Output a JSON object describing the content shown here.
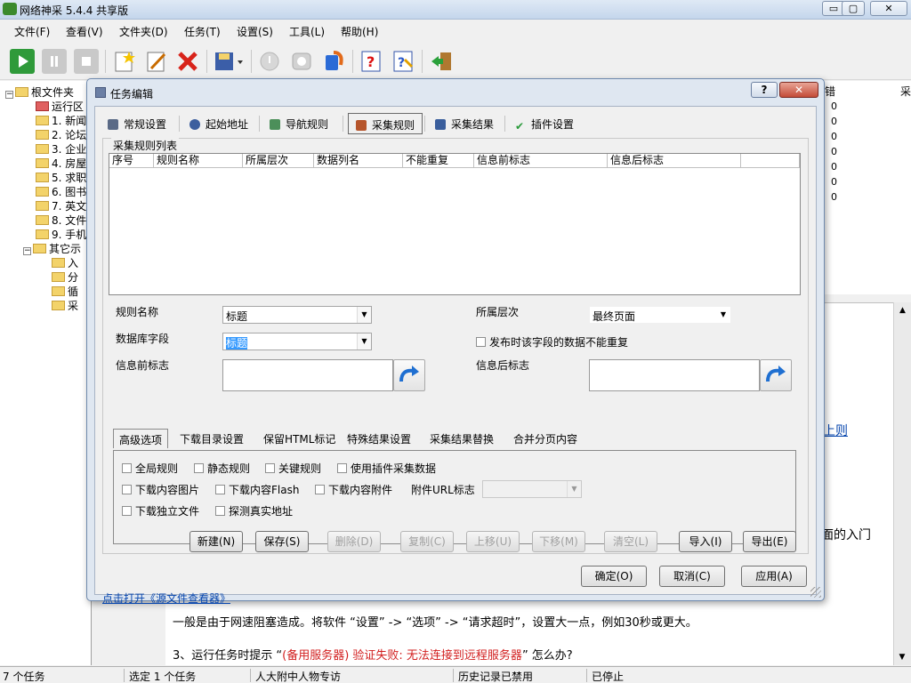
{
  "app": {
    "title": "网络神采 5.4.4 共享版",
    "min": "▭",
    "max": "▢",
    "close": "✕"
  },
  "menu": [
    "文件(F)",
    "查看(V)",
    "文件夹(D)",
    "任务(T)",
    "设置(S)",
    "工具(L)",
    "帮助(H)"
  ],
  "toolbar_icons": [
    "start-icon",
    "pause-icon",
    "stop-icon",
    "new-task-icon",
    "edit-task-icon",
    "delete-task-icon",
    "save-icon",
    "disabled-icon",
    "server-icon",
    "plugin-icon",
    "help-icon",
    "wizard-icon",
    "exit-icon"
  ],
  "tree": {
    "root": "根文件夹",
    "items": [
      "运行区",
      "1. 新闻",
      "2. 论坛",
      "3. 企业",
      "4. 房屋",
      "5. 求职",
      "6. 图书",
      "7. 英文",
      "8. 文件",
      "9. 手机"
    ],
    "other": "其它示",
    "other_children": [
      "入",
      "分",
      "循",
      "采"
    ]
  },
  "right_list": {
    "headers": [
      "错",
      "采"
    ],
    "values": [
      "0",
      "0",
      "0",
      "0",
      "0",
      "0",
      "0"
    ]
  },
  "content": {
    "link": "上则",
    "entry_tail": "面的入门",
    "line1": "一般是由于网速阻塞造成。将软件 “设置” -> “选项” -> “请求超时”，设置大一点，例如30秒或更大。",
    "line2_prefix": "3、运行任务时提示 “",
    "line2_red": "(备用服务器) 验证失败: 无法连接到远程服务器",
    "line2_suffix": "” 怎么办?"
  },
  "status": [
    "7 个任务",
    "选定 1 个任务",
    "人大附中人物专访",
    "历史记录已禁用",
    "已停止"
  ],
  "dialog": {
    "title": "任务编辑",
    "help": "?",
    "close": "✕",
    "tabs": [
      "常规设置",
      "起始地址",
      "导航规则",
      "采集规则",
      "采集结果",
      "插件设置"
    ],
    "group_label": "采集规则列表",
    "columns": [
      "序号",
      "规则名称",
      "所属层次",
      "数据列名",
      "不能重复",
      "信息前标志",
      "信息后标志"
    ],
    "rule_name_label": "规则名称",
    "rule_name_value": "标题",
    "db_field_label": "数据库字段",
    "db_field_value": "标题",
    "level_label": "所属层次",
    "level_value": "最终页面",
    "no_repeat_label": "发布时该字段的数据不能重复",
    "before_label": "信息前标志",
    "after_label": "信息后标志",
    "sub_tabs": [
      "高级选项",
      "下载目录设置",
      "保留HTML标记",
      "特殊结果设置",
      "采集结果替换",
      "合并分页内容"
    ],
    "checks": [
      "全局规则",
      "静态规则",
      "关键规则",
      "使用插件采集数据",
      "下载内容图片",
      "下载内容Flash",
      "下载内容附件",
      "下载独立文件",
      "探测真实地址"
    ],
    "attach_url_label": "附件URL标志",
    "buttons": [
      "新建(N)",
      "保存(S)",
      "删除(D)",
      "复制(C)",
      "上移(U)",
      "下移(M)",
      "清空(L)",
      "导入(I)",
      "导出(E)"
    ],
    "link": "点击打开《源文件查看器》",
    "ok": "确定(O)",
    "cancel": "取消(C)",
    "apply": "应用(A)"
  }
}
